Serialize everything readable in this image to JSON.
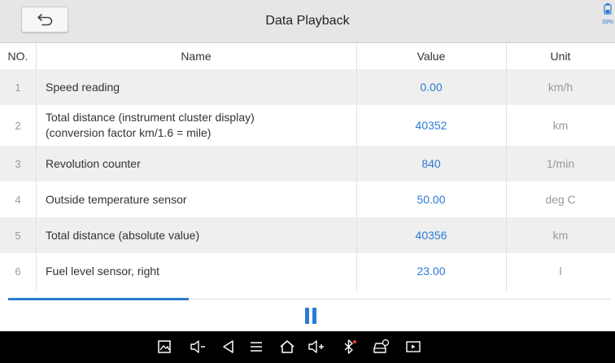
{
  "header": {
    "title": "Data Playback",
    "battery": "39%"
  },
  "table": {
    "headers": {
      "no": "NO.",
      "name": "Name",
      "value": "Value",
      "unit": "Unit"
    },
    "rows": [
      {
        "no": "1",
        "name": "Speed reading",
        "value": "0.00",
        "unit": "km/h"
      },
      {
        "no": "2",
        "name_line1": "Total distance (instrument cluster display)",
        "name_line2": "(conversion factor km/1.6 = mile)",
        "value": "40352",
        "unit": "km"
      },
      {
        "no": "3",
        "name": "Revolution counter",
        "value": "840",
        "unit": "1/min"
      },
      {
        "no": "4",
        "name": "Outside temperature sensor",
        "value": "50.00",
        "unit": "deg C"
      },
      {
        "no": "5",
        "name": "Total distance (absolute value)",
        "value": "40356",
        "unit": "km"
      },
      {
        "no": "6",
        "name": "Fuel level sensor, right",
        "value": "23.00",
        "unit": "l"
      }
    ]
  },
  "playback": {
    "progress": 0.3
  },
  "icons": {
    "back": "back-arrow-icon",
    "pause": "pause-icon",
    "nav": [
      "screenshot-icon",
      "volume-down-icon",
      "back-icon",
      "menu-icon",
      "home-icon",
      "volume-up-icon",
      "bluetooth-icon",
      "car-diagnostics-icon",
      "screen-record-icon"
    ]
  },
  "colors": {
    "accent": "#2b7bd4",
    "header_bg": "#e6e6e6",
    "row_alt": "#efefef",
    "nav_bg": "#000000"
  }
}
